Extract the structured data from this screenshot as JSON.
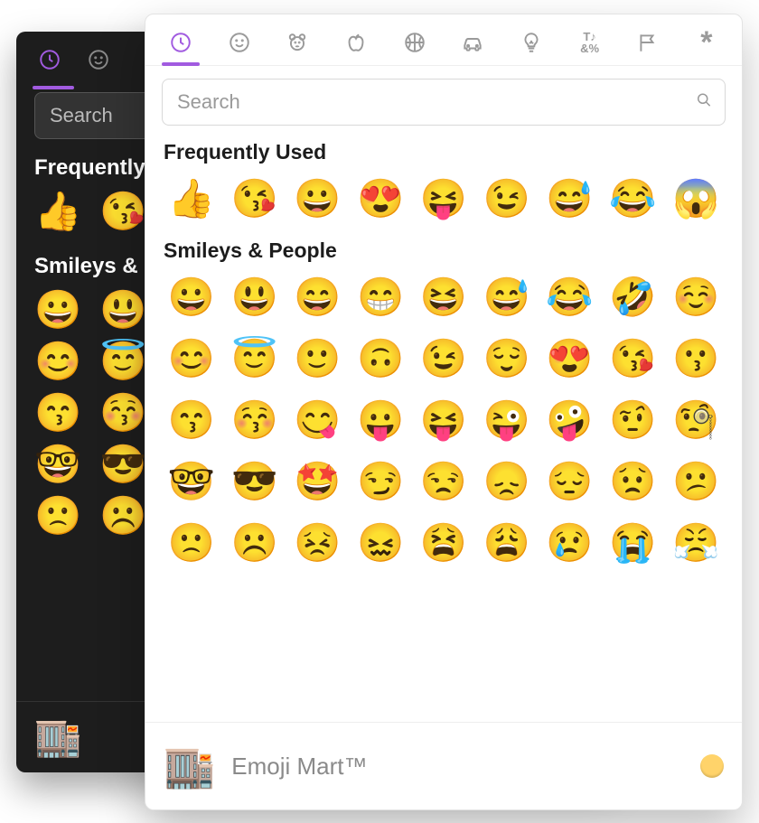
{
  "accent_color": "#a15be0",
  "dark": {
    "search_placeholder": "Search",
    "section_frequent_title": "Frequently Used",
    "section_smileys_title": "Smileys & People",
    "frequent_row": [
      "👍",
      "😘"
    ],
    "footer_preview": "🏬"
  },
  "light": {
    "tabs": [
      {
        "name": "recent",
        "active": true
      },
      {
        "name": "smileys",
        "active": false
      },
      {
        "name": "animals",
        "active": false
      },
      {
        "name": "food",
        "active": false
      },
      {
        "name": "activity",
        "active": false
      },
      {
        "name": "travel",
        "active": false
      },
      {
        "name": "objects",
        "active": false
      },
      {
        "name": "symbols",
        "active": false
      },
      {
        "name": "flags",
        "active": false
      },
      {
        "name": "custom",
        "active": false
      }
    ],
    "search_placeholder": "Search",
    "sections": [
      {
        "title": "Frequently Used",
        "emojis": [
          "👍",
          "😘",
          "😀",
          "😍",
          "😝",
          "😉",
          "😅",
          "😂",
          "😱"
        ]
      },
      {
        "title": "Smileys & People",
        "emojis": [
          "😀",
          "😃",
          "😄",
          "😁",
          "😆",
          "😅",
          "😂",
          "🤣",
          "☺️",
          "😊",
          "😇",
          "🙂",
          "🙃",
          "😉",
          "😌",
          "😍",
          "😘",
          "😗",
          "😙",
          "😚",
          "😋",
          "😛",
          "😝",
          "😜",
          "🤪",
          "🤨",
          "🧐",
          "🤓",
          "😎",
          "🤩",
          "😏",
          "😒",
          "😞",
          "😔",
          "😟",
          "😕",
          "🙁",
          "☹️",
          "😣",
          "😖",
          "😫",
          "😩",
          "😢",
          "😭",
          "😤"
        ]
      }
    ],
    "footer": {
      "preview_emoji": "🏬",
      "label": "Emoji Mart™"
    }
  }
}
